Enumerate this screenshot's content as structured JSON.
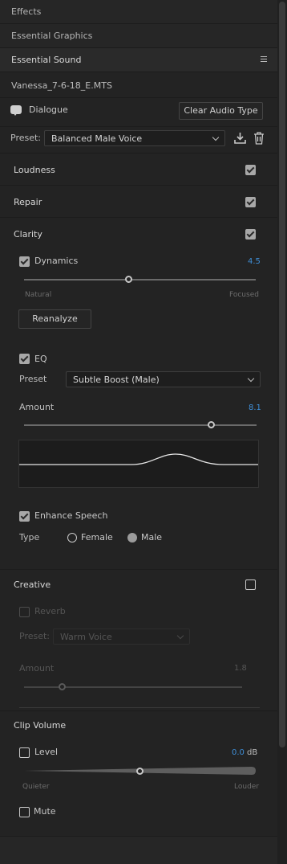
{
  "tabs": [
    {
      "label": "Effects"
    },
    {
      "label": "Essential Graphics"
    },
    {
      "label": "Essential Sound"
    }
  ],
  "clip_name": "Vanessa_7-6-18_E.MTS",
  "audio_type": {
    "label": "Dialogue",
    "clear_button": "Clear Audio Type"
  },
  "preset": {
    "label": "Preset:",
    "value": "Balanced Male Voice"
  },
  "loudness": {
    "title": "Loudness",
    "checked": true
  },
  "repair": {
    "title": "Repair",
    "checked": true
  },
  "clarity": {
    "title": "Clarity",
    "checked": true,
    "dynamics": {
      "label": "Dynamics",
      "value": "4.5",
      "min_label": "Natural",
      "max_label": "Focused",
      "level": 0.45
    },
    "reanalyze": "Reanalyze",
    "eq": {
      "label": "EQ",
      "preset_label": "Preset",
      "preset_value": "Subtle Boost (Male)",
      "amount_label": "Amount",
      "amount_value": "8.1",
      "level": 0.81
    },
    "enhance_speech": {
      "label": "Enhance Speech",
      "type_label": "Type",
      "options": [
        "Female",
        "Male"
      ],
      "selected": "Male"
    }
  },
  "creative": {
    "title": "Creative",
    "checked": false,
    "reverb": {
      "label": "Reverb",
      "preset_label": "Preset:",
      "preset_value": "Warm Voice",
      "amount_label": "Amount",
      "amount_value": "1.8",
      "level": 0.18
    }
  },
  "clip_volume": {
    "title": "Clip Volume",
    "level": {
      "label": "Level",
      "value": "0.0",
      "unit": "dB",
      "min_label": "Quieter",
      "max_label": "Louder"
    },
    "mute": {
      "label": "Mute"
    }
  },
  "colors": {
    "accent": "#3f8fd8",
    "panel": "#232323"
  }
}
